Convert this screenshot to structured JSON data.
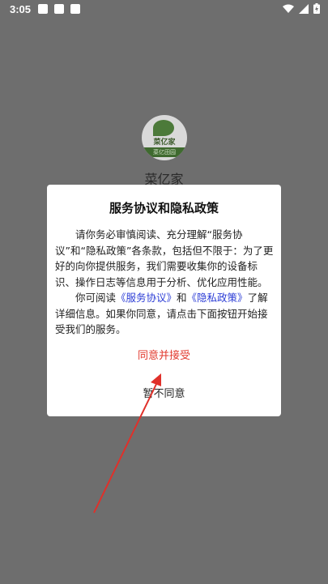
{
  "status_bar": {
    "time": "3:05"
  },
  "app": {
    "name": "菜亿家",
    "logo_text": "菜亿家",
    "logo_band_text": "菜亿田园"
  },
  "dialog": {
    "title": "服务协议和隐私政策",
    "para1": "请你务必审慎阅读、充分理解“服务协议”和“隐私政策”各条款，包括但不限于：为了更好的向你提供服务，我们需要收集你的设备标识、操作日志等信息用于分析、优化应用性能。",
    "para2_prefix": "你可阅读",
    "service_link": "《服务协议》",
    "para2_and": "和",
    "privacy_link": "《隐私政策》",
    "para2_suffix": "了解详细信息。如果你同意，请点击下面按钮开始接受我们的服务。",
    "agree_label": "同意并接受",
    "decline_label": "暂不同意"
  },
  "colors": {
    "overlay": "#6e6e6e",
    "link": "#2c3dd6",
    "agree": "#e23a2e",
    "arrow": "#e0302a"
  }
}
